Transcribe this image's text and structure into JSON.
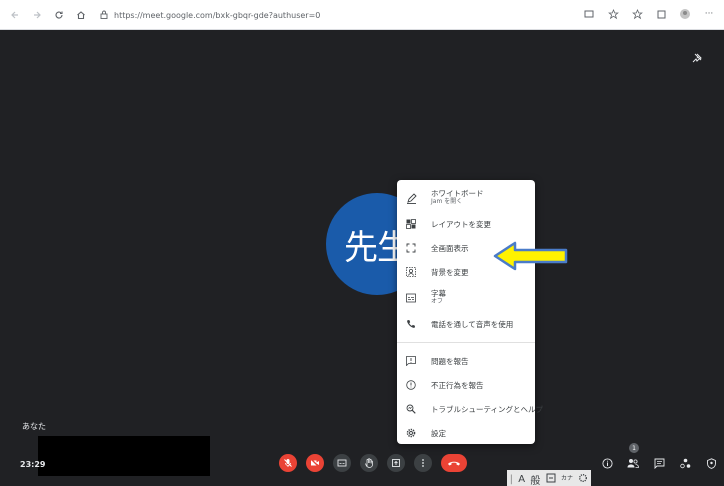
{
  "browser": {
    "url": "https://meet.google.com/bxk-gbqr-gde?authuser=0"
  },
  "avatar": {
    "label": "先生",
    "color": "#1a5baa"
  },
  "menu": {
    "items": [
      {
        "label": "ホワイトボード",
        "sub": "Jam を開く",
        "icon": "pencil-icon"
      },
      {
        "label": "レイアウトを変更",
        "icon": "layout-icon"
      },
      {
        "label": "全画面表示",
        "icon": "fullscreen-icon"
      },
      {
        "label": "背景を変更",
        "icon": "background-icon"
      },
      {
        "label": "字幕",
        "sub": "オフ",
        "icon": "captions-icon"
      },
      {
        "label": "電話を通して音声を使用",
        "icon": "phone-icon"
      },
      {
        "label": "問題を報告",
        "icon": "report-icon"
      },
      {
        "label": "不正行為を報告",
        "icon": "abuse-icon"
      },
      {
        "label": "トラブルシューティングとヘルプ",
        "icon": "troubleshoot-icon"
      },
      {
        "label": "設定",
        "icon": "settings-icon"
      }
    ]
  },
  "bottom": {
    "you_label": "あなた",
    "clock": "23:29",
    "participants_count": "1",
    "ime": [
      "A",
      "般",
      "カナ"
    ]
  },
  "colors": {
    "stage_bg": "#202124",
    "danger": "#ea4335",
    "callout_fill": "#fff200",
    "callout_stroke": "#4a7cc9"
  }
}
